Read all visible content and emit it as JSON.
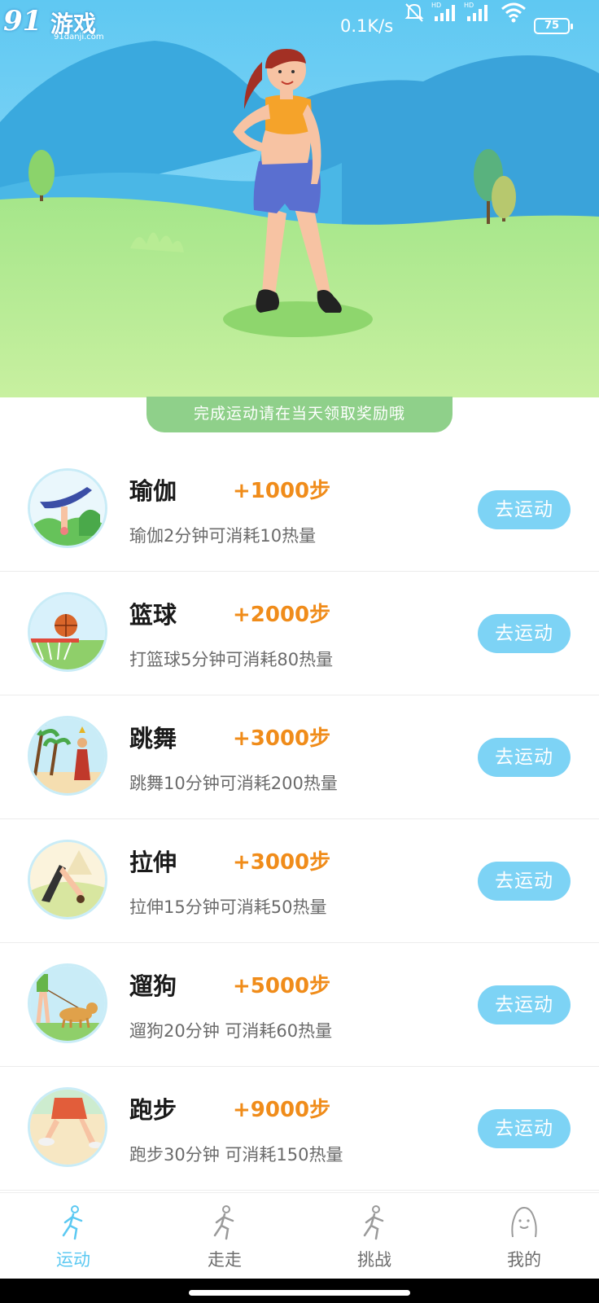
{
  "status_bar": {
    "watermark_num": "91",
    "watermark_cn": "游戏",
    "watermark_url": "91danji.com",
    "net_speed": "0.1K/s",
    "battery": "75"
  },
  "notice": "完成运动请在当天领取奖励哦",
  "activities": [
    {
      "name": "瑜伽",
      "steps": "+1000步",
      "desc": "瑜伽2分钟可消耗10热量",
      "button": "去运动"
    },
    {
      "name": "篮球",
      "steps": "+2000步",
      "desc": "打篮球5分钟可消耗80热量",
      "button": "去运动"
    },
    {
      "name": "跳舞",
      "steps": "+3000步",
      "desc": "跳舞10分钟可消耗200热量",
      "button": "去运动"
    },
    {
      "name": "拉伸",
      "steps": "+3000步",
      "desc": "拉伸15分钟可消耗50热量",
      "button": "去运动"
    },
    {
      "name": "遛狗",
      "steps": "+5000步",
      "desc": "遛狗20分钟 可消耗60热量",
      "button": "去运动"
    },
    {
      "name": "跑步",
      "steps": "+9000步",
      "desc": "跑步30分钟 可消耗150热量",
      "button": "去运动"
    }
  ],
  "nav": [
    {
      "label": "运动",
      "icon": "run-icon",
      "active": true
    },
    {
      "label": "走走",
      "icon": "walk-icon",
      "active": false
    },
    {
      "label": "挑战",
      "icon": "challenge-icon",
      "active": false
    },
    {
      "label": "我的",
      "icon": "profile-icon",
      "active": false
    }
  ],
  "colors": {
    "accent": "#7dd3f5",
    "steps": "#f08c1a",
    "notice": "#8fd08a",
    "nav_active": "#5cc9f2"
  }
}
